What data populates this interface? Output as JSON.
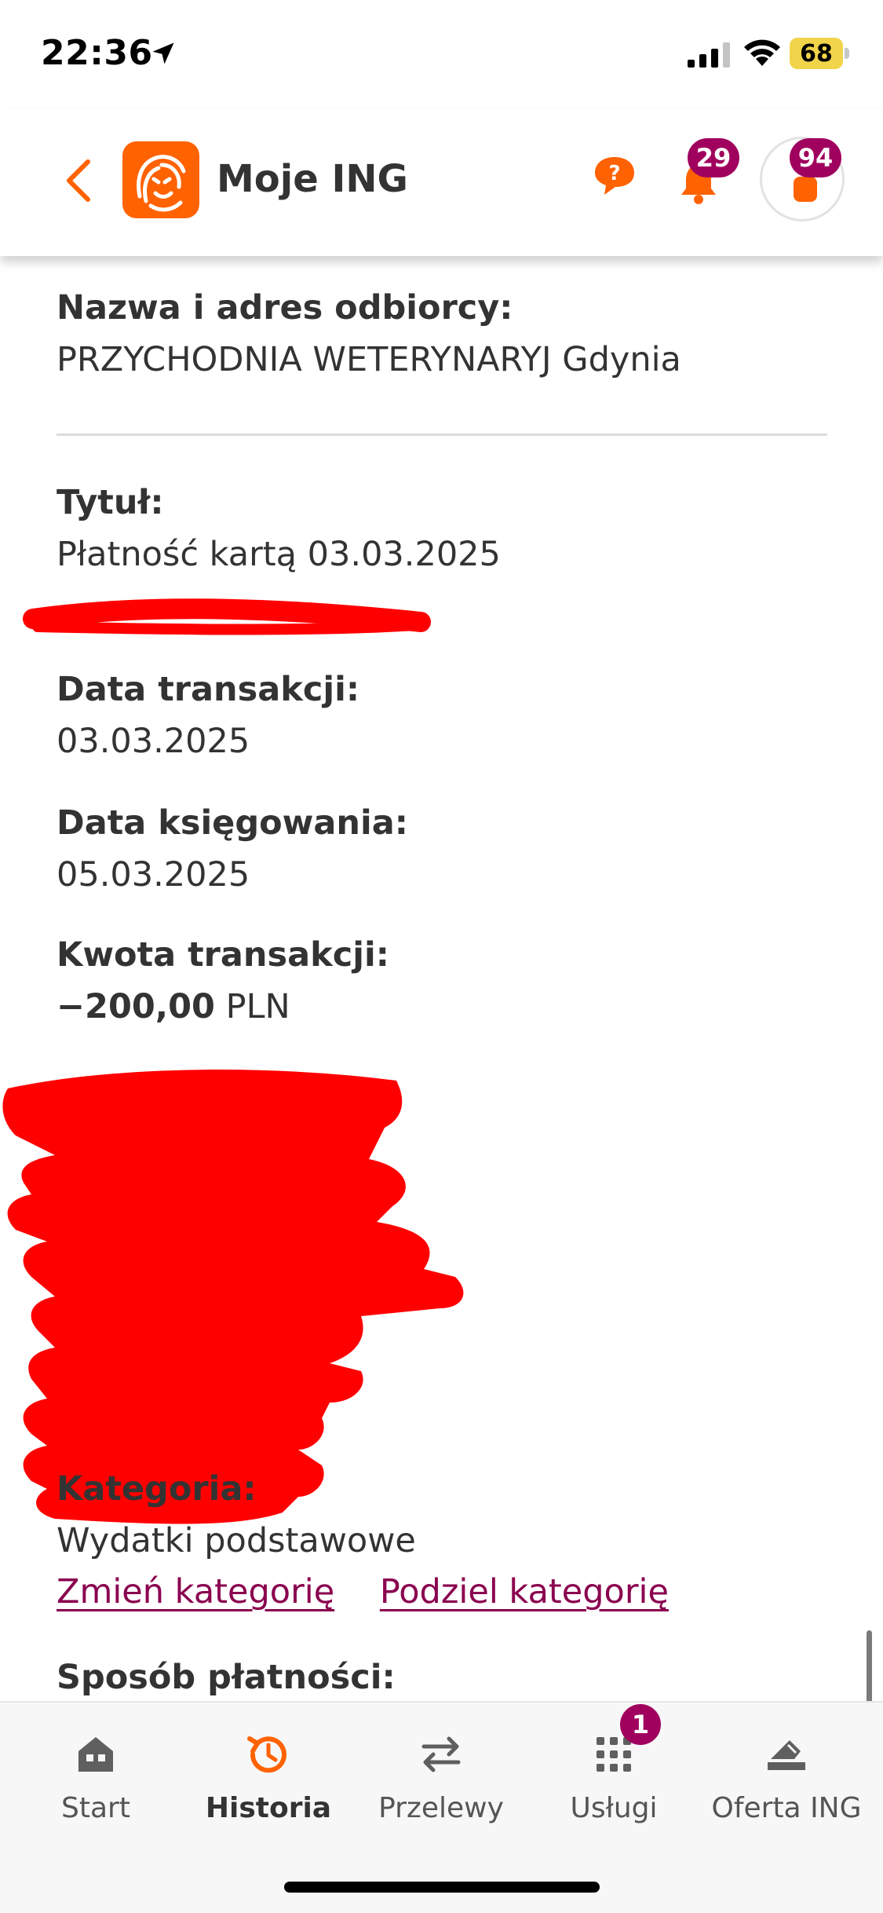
{
  "status_bar": {
    "time": "22:36",
    "battery": "68"
  },
  "header": {
    "title": "Moje ING",
    "notifications_count": "29",
    "profile_count": "94"
  },
  "colors": {
    "brand": "#ff6200",
    "accent": "#a0005e",
    "link": "#8a004f",
    "redaction": "#ff0000"
  },
  "details": {
    "recipient_label": "Nazwa i adres odbiorcy:",
    "recipient_value": "PRZYCHODNIA WETERYNARYJ Gdynia",
    "title_label": "Tytuł:",
    "title_value": "Płatność kartą 03.03.2025",
    "transaction_date_label": "Data transakcji:",
    "transaction_date_value": "03.03.2025",
    "booking_date_label": "Data księgowania:",
    "booking_date_value": "05.03.2025",
    "amount_label": "Kwota transakcji:",
    "amount_value": "−200,00",
    "amount_currency": "PLN",
    "category_label": "Kategoria:",
    "category_value": "Wydatki podstawowe",
    "change_category": "Zmień kategorię",
    "split_category": "Podziel kategorię",
    "payment_method_label": "Sposób płatności:"
  },
  "bottom_nav": {
    "items": [
      {
        "label": "Start",
        "icon": "home-icon"
      },
      {
        "label": "Historia",
        "icon": "history-icon",
        "active": true
      },
      {
        "label": "Przelewy",
        "icon": "transfer-arrows-icon"
      },
      {
        "label": "Usługi",
        "icon": "grid-dots-icon",
        "badge": "1"
      },
      {
        "label": "Oferta ING",
        "icon": "offer-icon"
      }
    ]
  }
}
